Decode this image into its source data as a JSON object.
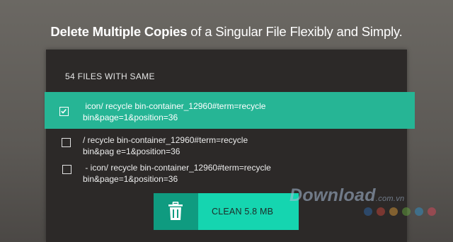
{
  "headline": {
    "bold": "Delete Multiple Copies",
    "rest": " of a Singular File Flexibly and Simply."
  },
  "panel": {
    "header": "54 FILES WITH SAME"
  },
  "files": [
    {
      "checked": true,
      "line1": " icon/ recycle bin-container_12960#term=recycle",
      "line2": "bin&page=1&position=36"
    },
    {
      "checked": false,
      "line1": "/ recycle bin-container_12960#term=recycle",
      "line2": "bin&pag e=1&position=36"
    },
    {
      "checked": false,
      "line1": " - icon/ recycle bin-container_12960#term=recycle",
      "line2": "bin&page=1&position=36"
    }
  ],
  "clean_button": {
    "label": "CLEAN 5.8 MB",
    "icon": "trash-icon"
  },
  "watermark": {
    "text": "Download",
    "suffix": ".com.vn",
    "dot_colors": [
      "#2e6fb7",
      "#d94a3c",
      "#e8a53a",
      "#6bb43f",
      "#2d9ad6",
      "#e8465a"
    ]
  },
  "colors": {
    "accent": "#26b595",
    "button": "#15d5b0",
    "button_icon_bg": "#0f9b80",
    "panel_bg": "#2c2928"
  }
}
